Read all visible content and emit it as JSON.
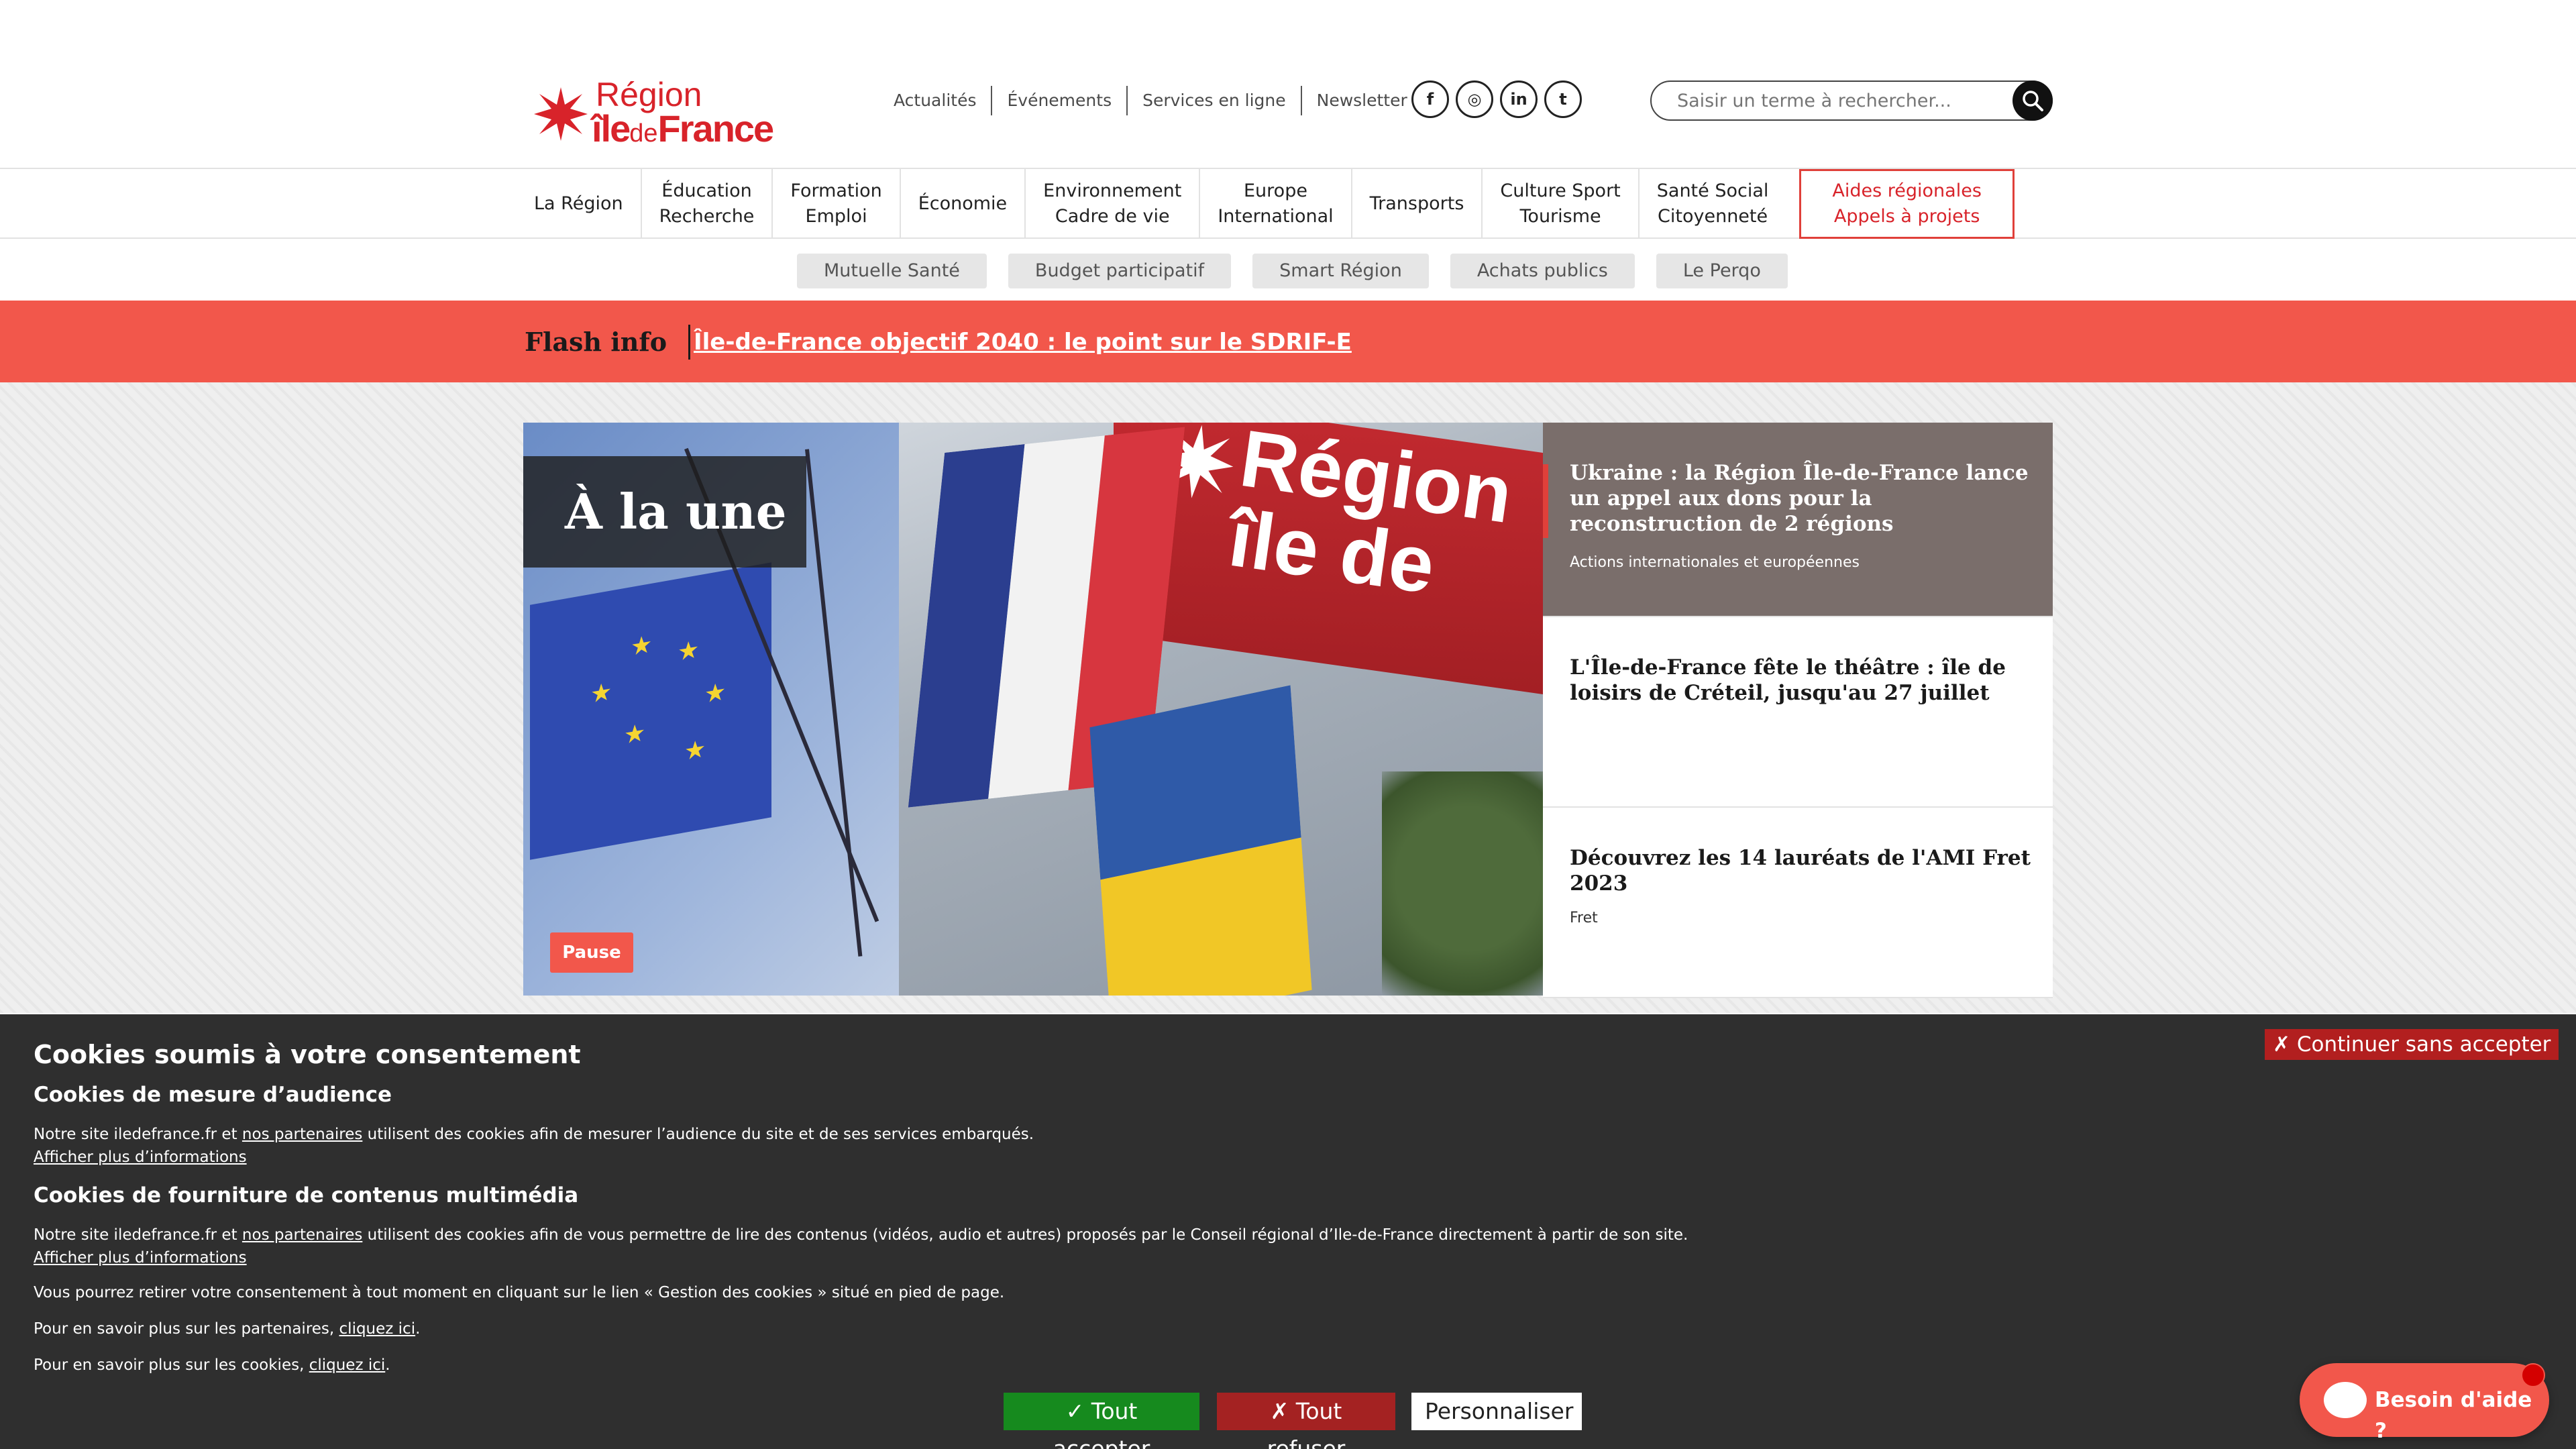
{
  "header": {
    "logo": {
      "line1": "Région",
      "line2a": "île",
      "line2b": "de",
      "line2c": "France"
    },
    "toplinks": [
      "Actualités",
      "Événements",
      "Services en ligne",
      "Newsletter"
    ],
    "socials": [
      {
        "icon": "facebook-icon",
        "glyph": "f"
      },
      {
        "icon": "instagram-icon",
        "glyph": "◎"
      },
      {
        "icon": "linkedin-icon",
        "glyph": "in"
      },
      {
        "icon": "twitter-icon",
        "glyph": "t"
      }
    ],
    "search": {
      "placeholder": "Saisir un terme à rechercher..."
    }
  },
  "mainnav": [
    {
      "l1": "La Région",
      "l2": ""
    },
    {
      "l1": "Éducation",
      "l2": "Recherche"
    },
    {
      "l1": "Formation",
      "l2": "Emploi"
    },
    {
      "l1": "Économie",
      "l2": ""
    },
    {
      "l1": "Environnement",
      "l2": "Cadre de vie"
    },
    {
      "l1": "Europe",
      "l2": "International"
    },
    {
      "l1": "Transports",
      "l2": ""
    },
    {
      "l1": "Culture Sport",
      "l2": "Tourisme"
    },
    {
      "l1": "Santé Social",
      "l2": "Citoyenneté"
    },
    {
      "l1": "Aides régionales",
      "l2": "Appels à projets"
    }
  ],
  "subnav": [
    "Mutuelle Santé",
    "Budget participatif",
    "Smart Région",
    "Achats publics",
    "Le Perqo"
  ],
  "flash": {
    "label": "Flash info",
    "link": "Île-de-France objectif 2040 : le point sur le SDRIF-E"
  },
  "hero": {
    "heading": "À la une",
    "sign_text": "Région\nîle de",
    "pause_label": "Pause"
  },
  "news": [
    {
      "title": "Ukraine : la Région Île-de-France lance un appel aux dons pour la reconstruction de 2 régions",
      "category": "Actions internationales et européennes"
    },
    {
      "title": "L'Île-de-France fête le théâtre : île de loisirs de Créteil, jusqu'au 27 juillet",
      "category": ""
    },
    {
      "title": "Découvrez les 14 lauréats de l'AMI Fret 2023",
      "category": "Fret"
    }
  ],
  "cookie": {
    "title": "Cookies soumis à votre consentement",
    "continue": "✗ Continuer sans accepter",
    "audience": {
      "heading": "Cookies de mesure d’audience",
      "text_before": "Notre site iledefrance.fr et ",
      "partners": "nos partenaires",
      "text_after": " utilisent des cookies afin de mesurer l’audience du site et de ses services embarqués.",
      "more": "Afficher plus d’informations"
    },
    "media": {
      "heading": "Cookies de fourniture de contenus multimédia",
      "text_before": "Notre site iledefrance.fr et ",
      "partners": "nos partenaires",
      "text_after": " utilisent des cookies afin de vous permettre de lire des contenus (vidéos, audio et autres) proposés par le Conseil régional d’Ile-de-France directement à partir de son site.",
      "more": "Afficher plus d’informations"
    },
    "withdraw": "Vous pourrez retirer votre consentement à tout moment en cliquant sur le lien « Gestion des cookies » situé en pied de page.",
    "partners_more": {
      "before": "Pour en savoir plus sur les partenaires, ",
      "link": "cliquez ici",
      "after": "."
    },
    "cookies_more": {
      "before": "Pour en savoir plus sur les cookies, ",
      "link": "cliquez ici",
      "after": "."
    },
    "accept": "✓ Tout accepter",
    "refuse": "✗ Tout refuser",
    "customize": "Personnaliser"
  },
  "help": {
    "label": "Besoin d'aide ?"
  },
  "colors": {
    "brand_red": "#d8232a",
    "flash_bg": "#f2574b",
    "cookie_bg": "#2f2f2f",
    "accept": "#168a1e",
    "refuse": "#a42222"
  }
}
